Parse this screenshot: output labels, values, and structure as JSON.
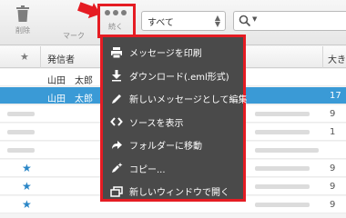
{
  "toolbar": {
    "delete_label": "削除",
    "mark_label": "マーク",
    "more_label": "続く",
    "filter_value": "すべて"
  },
  "list": {
    "header": {
      "sender": "発信者",
      "size": "大き"
    },
    "rows": [
      {
        "sender": "山田　太郎",
        "size": "",
        "selected": false,
        "starred": false
      },
      {
        "sender": "山田　太郎",
        "size": "17",
        "selected": true,
        "starred": false
      },
      {
        "sender": "",
        "size": "9",
        "selected": false,
        "starred": false
      },
      {
        "sender": "",
        "size": "1",
        "selected": false,
        "starred": false
      },
      {
        "sender": "",
        "size": "",
        "selected": false,
        "starred": false
      },
      {
        "sender": "",
        "size": "",
        "selected": false,
        "starred": false
      },
      {
        "sender": "",
        "size": "9",
        "selected": false,
        "starred": true
      },
      {
        "sender": "",
        "size": "9",
        "selected": false,
        "starred": true
      },
      {
        "sender": "",
        "size": "9",
        "selected": false,
        "starred": true
      }
    ]
  },
  "menu": {
    "items": [
      {
        "label": "メッセージを印刷",
        "icon": "printer-icon"
      },
      {
        "label": "ダウンロード(.eml形式)",
        "icon": "download-icon"
      },
      {
        "label": "新しいメッセージとして編集",
        "icon": "pencil-icon"
      },
      {
        "label": "ソースを表示",
        "icon": "code-icon"
      },
      {
        "label": "フォルダーに移動",
        "icon": "move-folder-icon"
      },
      {
        "label": "コピー...",
        "icon": "copy-icon"
      },
      {
        "label": "新しいウィンドウで開く",
        "icon": "new-window-icon"
      }
    ]
  },
  "colors": {
    "highlight": "#e51c23",
    "menu_bg": "#4a4a4a",
    "selected_row": "#3a9ad6",
    "star": "#2a86c7"
  }
}
